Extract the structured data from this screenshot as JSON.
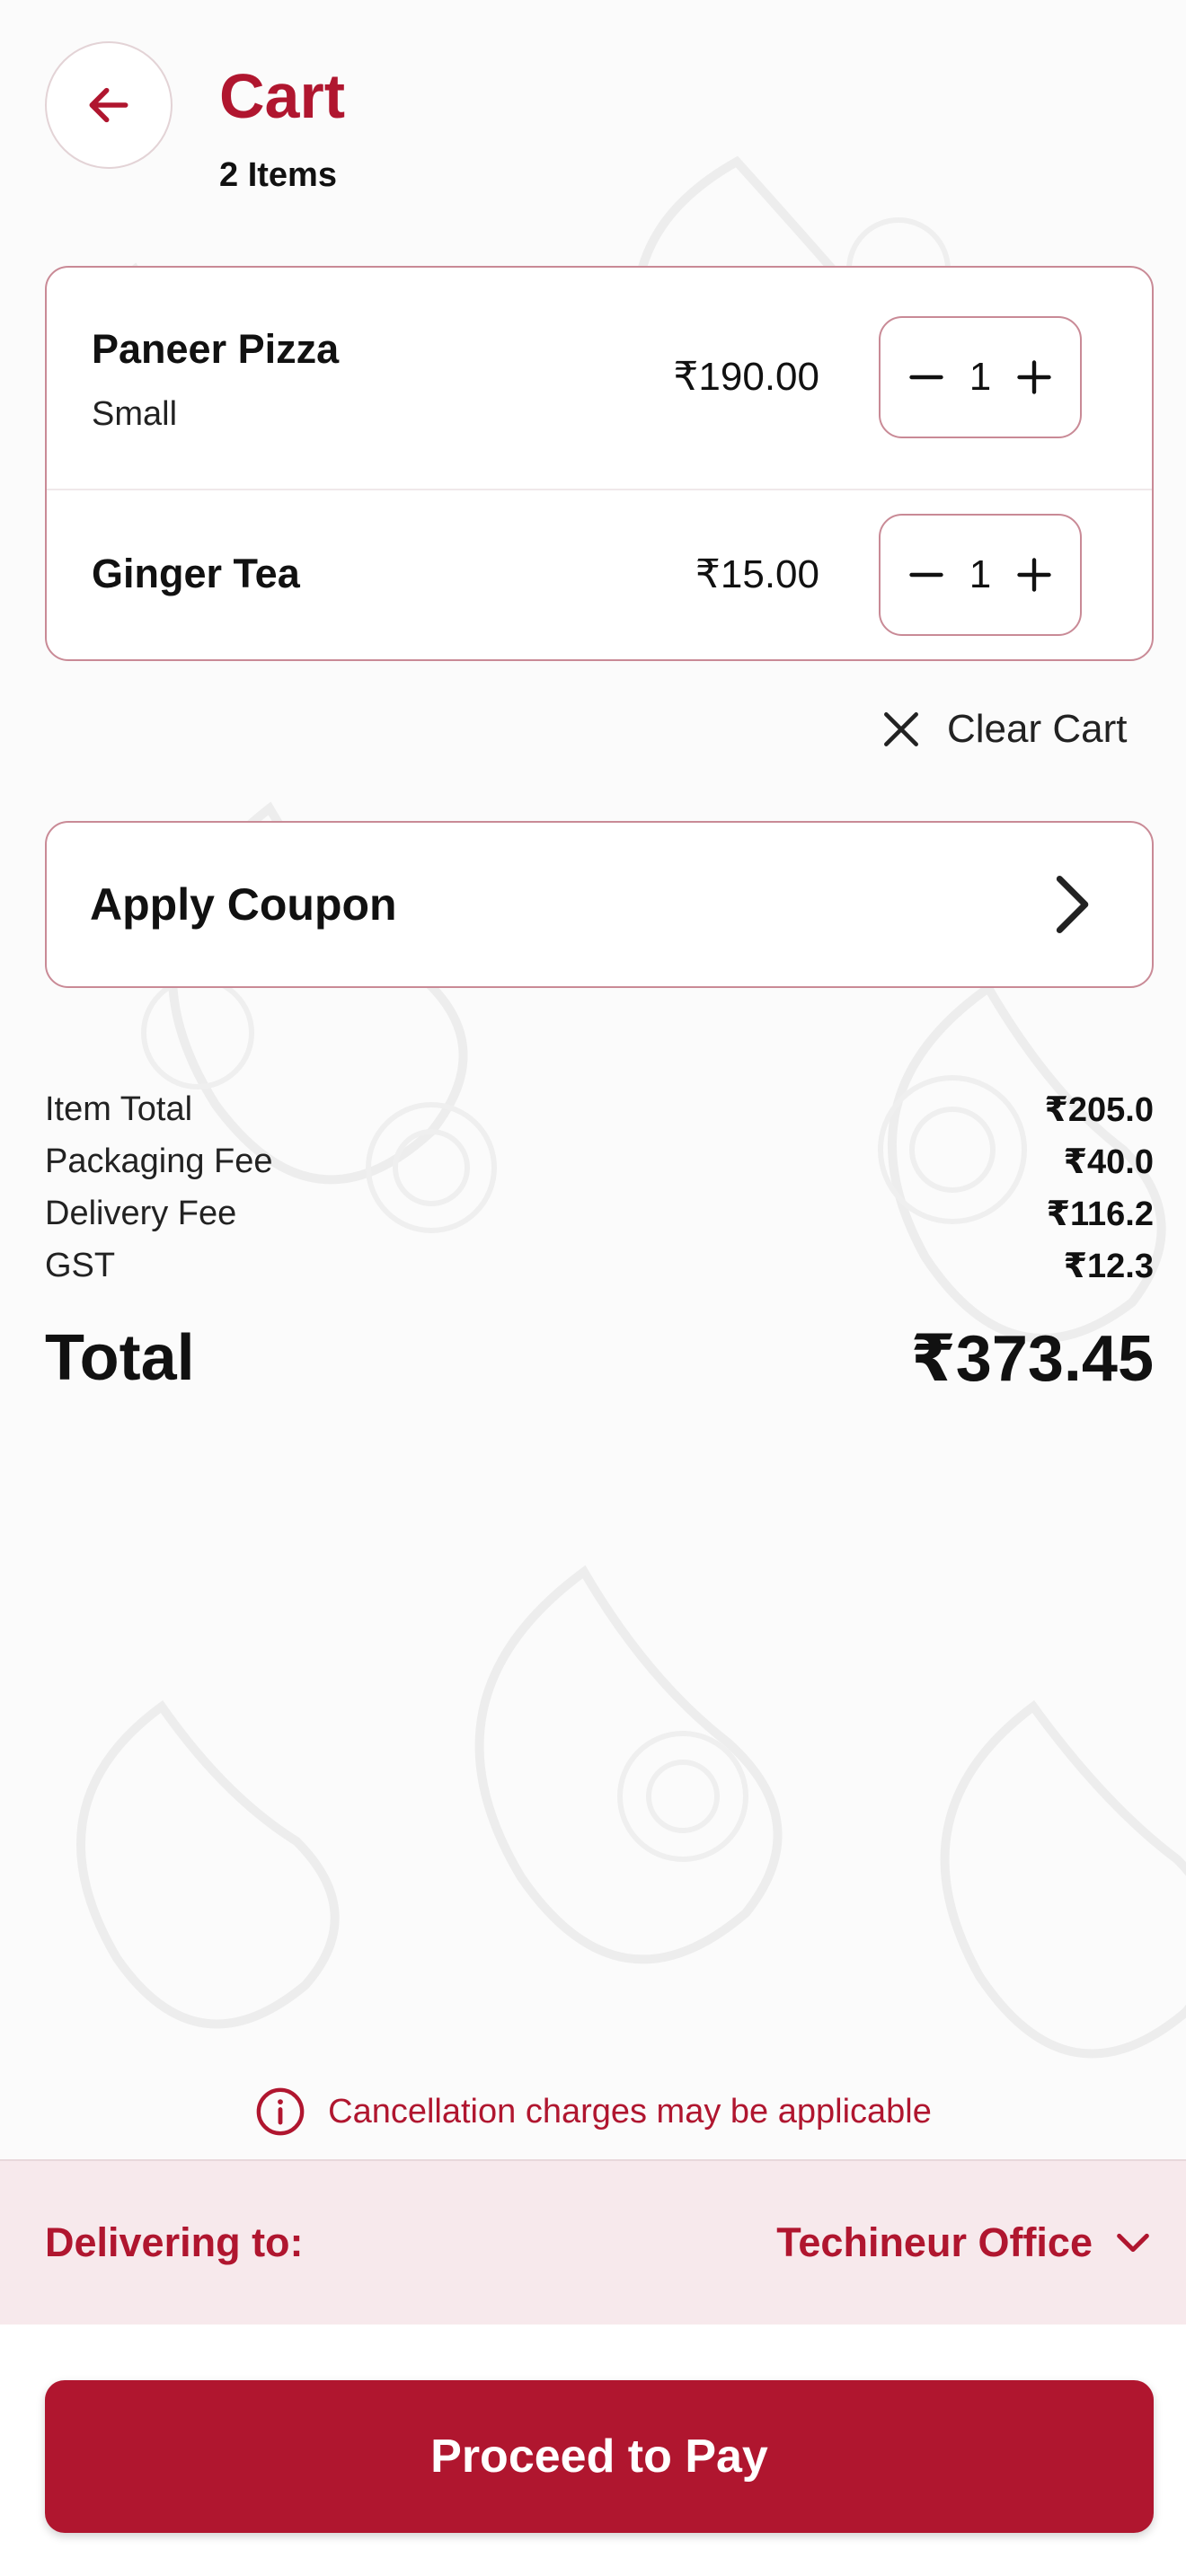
{
  "header": {
    "title": "Cart",
    "subtitle": "2 Items",
    "back_icon": "arrow-left-icon"
  },
  "cart": {
    "items": [
      {
        "name": "Paneer Pizza",
        "variant": "Small",
        "price": "₹190.00",
        "quantity": "1"
      },
      {
        "name": "Ginger Tea",
        "variant": "",
        "price": "₹15.00",
        "quantity": "1"
      }
    ],
    "clear_label": "Clear Cart"
  },
  "coupon": {
    "label": "Apply Coupon"
  },
  "bill": {
    "rows": [
      {
        "label": "Item Total",
        "value": "₹205.0"
      },
      {
        "label": "Packaging Fee",
        "value": "₹40.0"
      },
      {
        "label": "Delivery Fee",
        "value": "₹116.2"
      },
      {
        "label": "GST",
        "value": "₹12.3"
      }
    ],
    "total_label": "Total",
    "total_value": "₹373.45"
  },
  "notice": {
    "text": "Cancellation charges may be applicable"
  },
  "delivery": {
    "label": "Delivering to:",
    "value": "Techineur Office"
  },
  "pay_button": {
    "label": "Proceed to Pay"
  },
  "colors": {
    "brand": "#b0162f",
    "border": "#c98a96",
    "delivery_bg": "#f7e9ec"
  }
}
